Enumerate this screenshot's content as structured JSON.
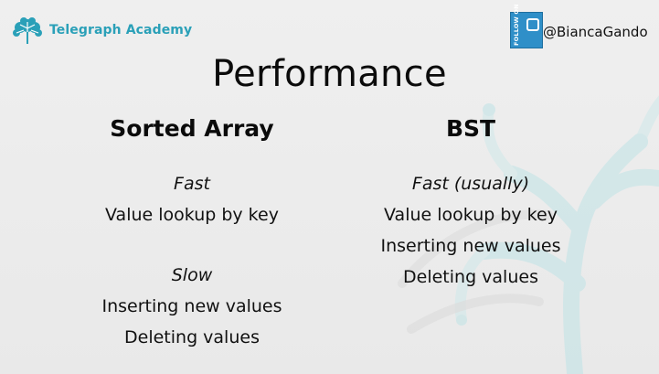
{
  "brand": {
    "name": "Telegraph Academy",
    "logo_icon": "tree-logo-icon",
    "color": "#2aa0b8"
  },
  "follow": {
    "badge_text": "FOLLOW ON",
    "badge_icon": "twitter-bird-icon",
    "badge_color": "#2f8fc8",
    "handle": "@BiancaGando"
  },
  "title": "Performance",
  "columns": [
    {
      "heading": "Sorted Array",
      "groups": [
        {
          "label": "Fast",
          "items": [
            "Value lookup by key"
          ]
        },
        {
          "label": "Slow",
          "items": [
            "Inserting new values",
            "Deleting values"
          ]
        }
      ]
    },
    {
      "heading": "BST",
      "groups": [
        {
          "label": "Fast (usually)",
          "items": [
            "Value lookup by key",
            "Inserting new values",
            "Deleting values"
          ]
        }
      ]
    }
  ],
  "watermark_icon": "tree-watermark-icon"
}
